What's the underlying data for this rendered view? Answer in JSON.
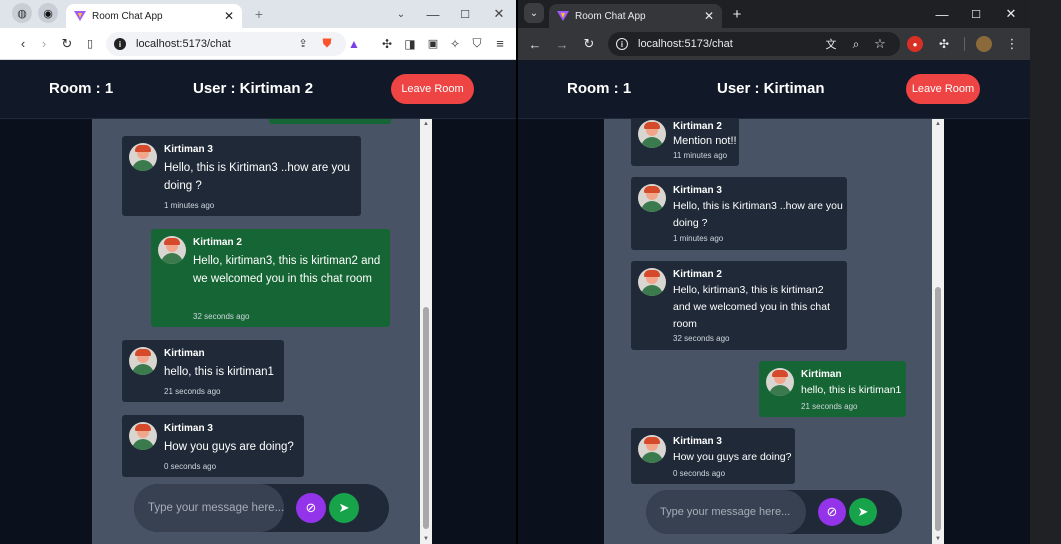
{
  "windows": [
    {
      "tab_title": "Room Chat App",
      "url": "localhost:5173/chat",
      "header": {
        "room": "Room : 1",
        "user": "User : Kirtiman 2",
        "leave": "Leave Room"
      },
      "messages": [
        {
          "side": "other",
          "sender": "Kirtiman 3",
          "text": "Hello, this is Kirtiman3 ..how are you doing ?",
          "time": "1 minutes ago"
        },
        {
          "side": "me",
          "sender": "Kirtiman 2",
          "text": "Hello, kirtiman3, this is kirtiman2 and we welcomed you in this chat room",
          "time": "32 seconds ago"
        },
        {
          "side": "other",
          "sender": "Kirtiman",
          "text": "hello, this is kirtiman1",
          "time": "21 seconds ago"
        },
        {
          "side": "other",
          "sender": "Kirtiman 3",
          "text": "How you guys are doing?",
          "time": "0 seconds ago"
        }
      ],
      "compose_placeholder": "Type your message here..."
    },
    {
      "tab_title": "Room Chat App",
      "url": "localhost:5173/chat",
      "header": {
        "room": "Room : 1",
        "user": "User : Kirtiman",
        "leave": "Leave Room"
      },
      "messages": [
        {
          "side": "other",
          "sender": "Kirtiman 2",
          "text": "Mention not!!",
          "time": "11 minutes ago"
        },
        {
          "side": "other",
          "sender": "Kirtiman 3",
          "text": "Hello, this is Kirtiman3 ..how are you doing ?",
          "time": "1 minutes ago"
        },
        {
          "side": "other",
          "sender": "Kirtiman 2",
          "text": "Hello, kirtiman3, this is kirtiman2 and we welcomed you in this chat room",
          "time": "32 seconds ago"
        },
        {
          "side": "me",
          "sender": "Kirtiman",
          "text": "hello, this is kirtiman1",
          "time": "21 seconds ago"
        },
        {
          "side": "other",
          "sender": "Kirtiman 3",
          "text": "How you guys are doing?",
          "time": "0 seconds ago"
        }
      ],
      "compose_placeholder": "Type your message here..."
    }
  ],
  "colors": {
    "my_message": "#166534",
    "other_message": "#1f2937",
    "leave_button": "#ef4444",
    "attach_button": "#9333ea",
    "send_button": "#16a34a"
  },
  "icons": [
    "back-icon",
    "forward-icon",
    "reload-icon",
    "bookmark-icon",
    "share-icon",
    "extensions-icon",
    "attach-icon",
    "send-icon",
    "star-icon",
    "zoom-icon",
    "translate-icon",
    "menu-icon"
  ]
}
